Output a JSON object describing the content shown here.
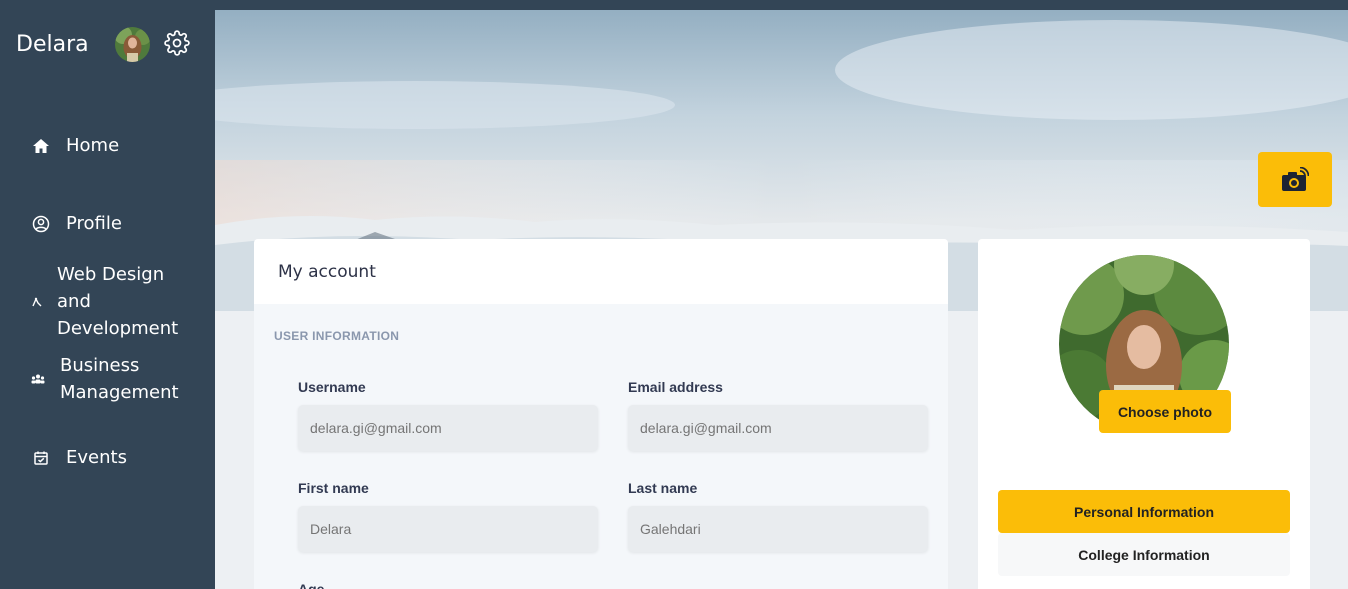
{
  "sidebar": {
    "brand": "Delara",
    "nav": [
      {
        "label": "Home",
        "icon": "home-icon"
      },
      {
        "label": "Profile",
        "icon": "user-circle-icon"
      },
      {
        "label": "Web Design and Development",
        "line1": "Web Design",
        "line2": "and",
        "line3": "Development",
        "icon": "web-design-icon"
      },
      {
        "label": "Business Management",
        "line1": "Business",
        "line2": "Management",
        "icon": "team-icon"
      },
      {
        "label": "Events",
        "icon": "calendar-icon"
      }
    ]
  },
  "header": {
    "camera_icon": "camera-icon"
  },
  "account": {
    "title": "My account",
    "section_title": "USER INFORMATION",
    "fields": [
      {
        "label": "Username",
        "placeholder": "delara.gi@gmail.com"
      },
      {
        "label": "Email address",
        "placeholder": "delara.gi@gmail.com"
      },
      {
        "label": "First name",
        "placeholder": "Delara"
      },
      {
        "label": "Last name",
        "placeholder": "Galehdari"
      },
      {
        "label": "Age"
      }
    ]
  },
  "profile": {
    "choose_photo": "Choose photo",
    "tabs": [
      {
        "label": "Personal Information",
        "active": true
      },
      {
        "label": "College Information",
        "active": false
      }
    ]
  },
  "colors": {
    "sidebar_bg": "#334556",
    "accent": "#fbbd08",
    "card_bg": "#f4f7fa"
  }
}
